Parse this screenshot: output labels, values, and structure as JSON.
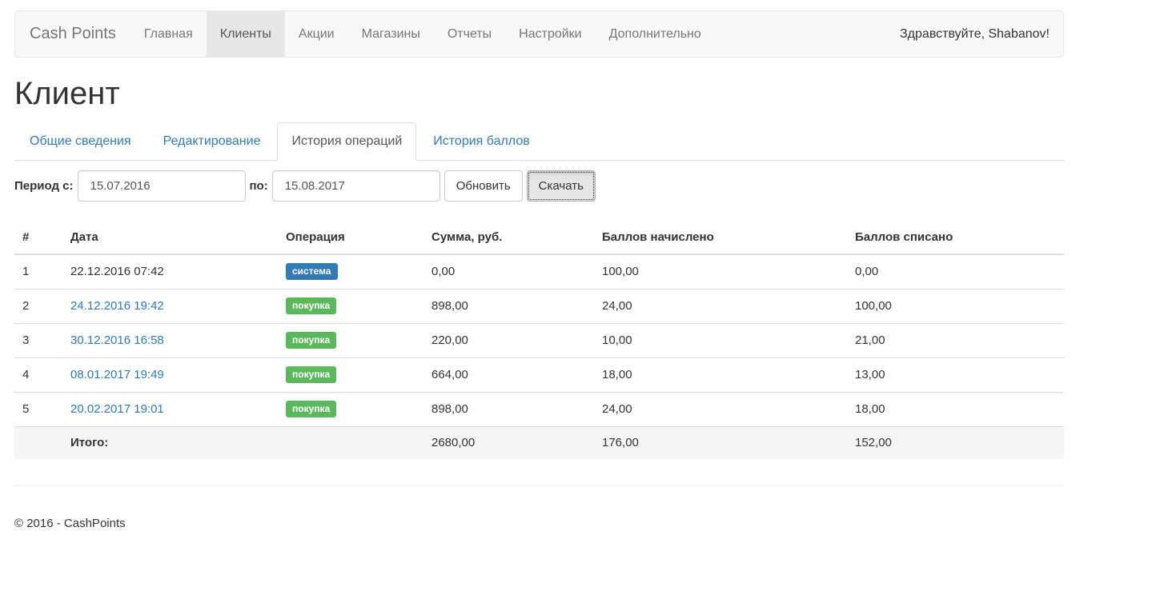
{
  "navbar": {
    "brand": "Cash Points",
    "items": [
      {
        "label": "Главная"
      },
      {
        "label": "Клиенты",
        "active": true
      },
      {
        "label": "Акции"
      },
      {
        "label": "Магазины"
      },
      {
        "label": "Отчеты"
      },
      {
        "label": "Настройки"
      },
      {
        "label": "Дополнительно"
      }
    ],
    "greeting": "Здравствуйте, Shabanov!"
  },
  "page": {
    "title": "Клиент"
  },
  "tabs": [
    {
      "label": "Общие сведения"
    },
    {
      "label": "Редактирование"
    },
    {
      "label": "История операций",
      "active": true
    },
    {
      "label": "История баллов"
    }
  ],
  "filter": {
    "from_label": "Период с:",
    "from_value": "15.07.2016",
    "to_label": "по:",
    "to_value": "15.08.2017",
    "refresh_label": "Обновить",
    "download_label": "Скачать"
  },
  "table": {
    "headers": [
      "#",
      "Дата",
      "Операция",
      "Сумма, руб.",
      "Баллов начислено",
      "Баллов списано"
    ],
    "rows": [
      {
        "n": "1",
        "date": "22.12.2016 07:42",
        "date_link": false,
        "op": "система",
        "op_color": "#337ab7",
        "sum": "0,00",
        "added": "100,00",
        "spent": "0,00"
      },
      {
        "n": "2",
        "date": "24.12.2016 19:42",
        "date_link": true,
        "op": "покупка",
        "op_color": "#5cb85c",
        "sum": "898,00",
        "added": "24,00",
        "spent": "100,00"
      },
      {
        "n": "3",
        "date": "30.12.2016 16:58",
        "date_link": true,
        "op": "покупка",
        "op_color": "#5cb85c",
        "sum": "220,00",
        "added": "10,00",
        "spent": "21,00"
      },
      {
        "n": "4",
        "date": "08.01.2017 19:49",
        "date_link": true,
        "op": "покупка",
        "op_color": "#5cb85c",
        "sum": "664,00",
        "added": "18,00",
        "spent": "13,00"
      },
      {
        "n": "5",
        "date": "20.02.2017 19:01",
        "date_link": true,
        "op": "покупка",
        "op_color": "#5cb85c",
        "sum": "898,00",
        "added": "24,00",
        "spent": "18,00"
      }
    ],
    "total": {
      "label": "Итого:",
      "sum": "2680,00",
      "added": "176,00",
      "spent": "152,00"
    }
  },
  "footer": {
    "text": "© 2016 - CashPoints"
  }
}
